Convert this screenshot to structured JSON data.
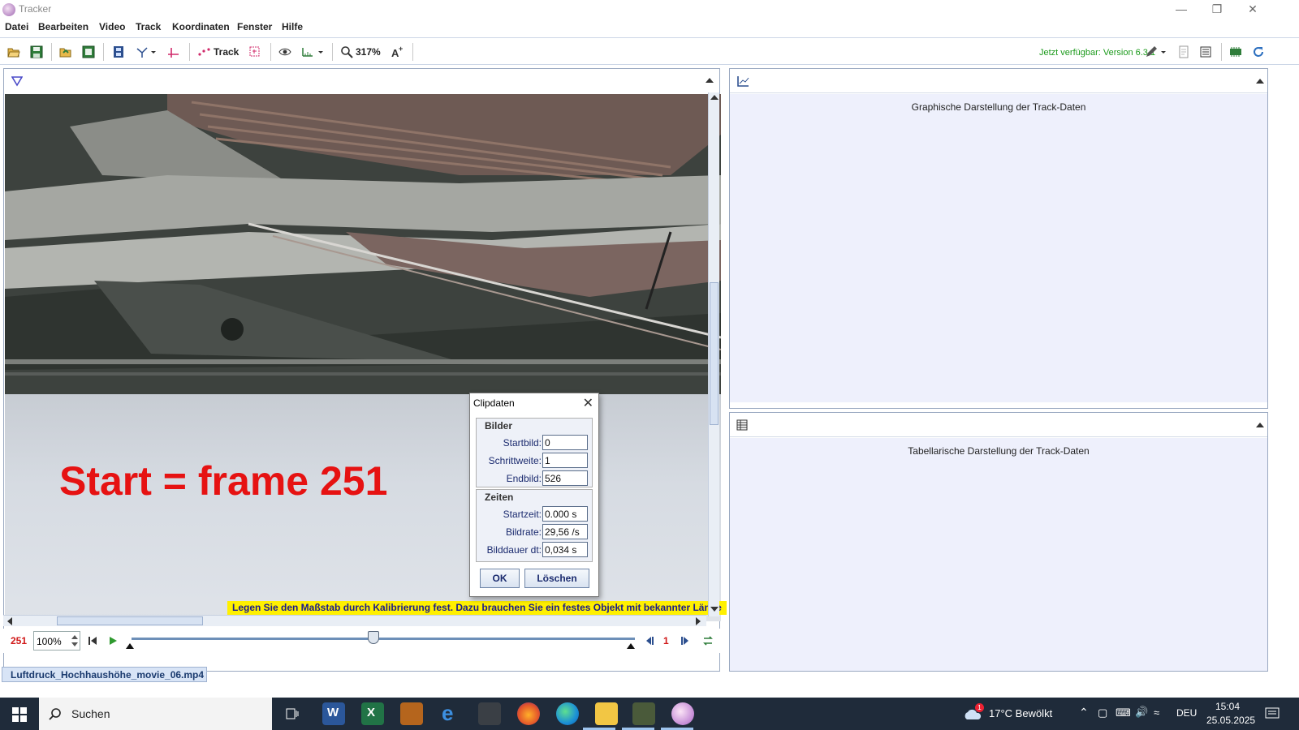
{
  "window": {
    "title": "Tracker"
  },
  "menu": [
    "Datei",
    "Bearbeiten",
    "Video",
    "Track",
    "Koordinaten",
    "Fenster",
    "Hilfe"
  ],
  "toolbar": {
    "track_label": "Track",
    "zoom_label": "317%",
    "available_text": "Jetzt verfügbar: Version 6.3.1"
  },
  "video": {
    "overlay_text": "Start = frame 251",
    "hint_text": "Legen Sie den Maßstab durch Kalibrierung fest. Dazu brauchen Sie ein festes Objekt mit bekannter Länge"
  },
  "player": {
    "current_frame": "251",
    "rate": "100%",
    "step": "1",
    "slider_position": 0.48
  },
  "file_tab": "Luftdruck_Hochhaushöhe_movie_06.mp4",
  "panels": {
    "plot_caption": "Graphische Darstellung der Track-Daten",
    "table_caption": "Tabellarische Darstellung der Track-Daten"
  },
  "dialog": {
    "title": "Clipdaten",
    "group_frames": "Bilder",
    "group_times": "Zeiten",
    "fields": {
      "startbild": {
        "label": "Startbild:",
        "value": "0"
      },
      "schrittweite": {
        "label": "Schrittweite:",
        "value": "1"
      },
      "endbild": {
        "label": "Endbild:",
        "value": "526"
      },
      "startzeit": {
        "label": "Startzeit:",
        "value": "0.000 s"
      },
      "bildrate": {
        "label": "Bildrate:",
        "value": "29,56 /s"
      },
      "bilddauer": {
        "label": "Bilddauer dt:",
        "value": "0,034 s"
      }
    },
    "ok_label": "OK",
    "delete_label": "Löschen"
  },
  "taskbar": {
    "search_label": "Suchen",
    "weather": "17°C  Bewölkt",
    "language": "DEU",
    "time": "15:04",
    "date": "25.05.2025",
    "weather_badge": "1"
  },
  "colors": {
    "accent_green": "#1c9a1c",
    "frame_red": "#d01818",
    "overlay_red": "#e61212",
    "hint_yellow": "#fff000",
    "panel_bg": "#eef0fc"
  }
}
